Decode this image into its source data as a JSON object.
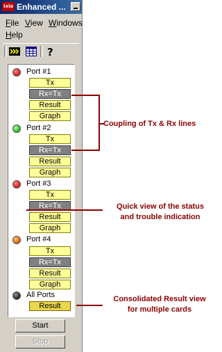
{
  "window": {
    "title": "Enhanced ...",
    "app_icon_text": "Ixia",
    "minimize_icon": "minimize-icon"
  },
  "menu": [
    "File",
    "View",
    "Windows",
    "Help"
  ],
  "toolbar": {
    "icons": [
      "run-forward-icon",
      "grid-view-icon",
      "help-icon"
    ]
  },
  "ports": [
    {
      "label": "Port #1",
      "led_color": "#e02020",
      "buttons": [
        "Tx",
        "Rx=Tx",
        "Result",
        "Graph"
      ]
    },
    {
      "label": "Port #2",
      "led_color": "#30c030",
      "buttons": [
        "Tx",
        "Rx=Tx",
        "Result",
        "Graph"
      ]
    },
    {
      "label": "Port #3",
      "led_color": "#e02020",
      "buttons": [
        "Tx",
        "Rx=Tx",
        "Result",
        "Graph"
      ]
    },
    {
      "label": "Port #4",
      "led_color": "#e07010",
      "buttons": [
        "Tx",
        "Rx=Tx",
        "Result",
        "Graph"
      ]
    }
  ],
  "all_ports": {
    "label": "All Ports",
    "led_color": "#303030",
    "button": "Result"
  },
  "controls": {
    "start": "Start",
    "stop": "Stop"
  },
  "annotations": {
    "coupling": "Coupling of Tx & Rx lines",
    "quick_view_1": "Quick view of the status",
    "quick_view_2": "and trouble indication",
    "consolidated_1": "Consolidated Result view",
    "consolidated_2": "for multiple cards"
  },
  "colors": {
    "button_yellow": "#ffff99",
    "button_gray": "#808080",
    "annotation_text": "#8b0000"
  }
}
